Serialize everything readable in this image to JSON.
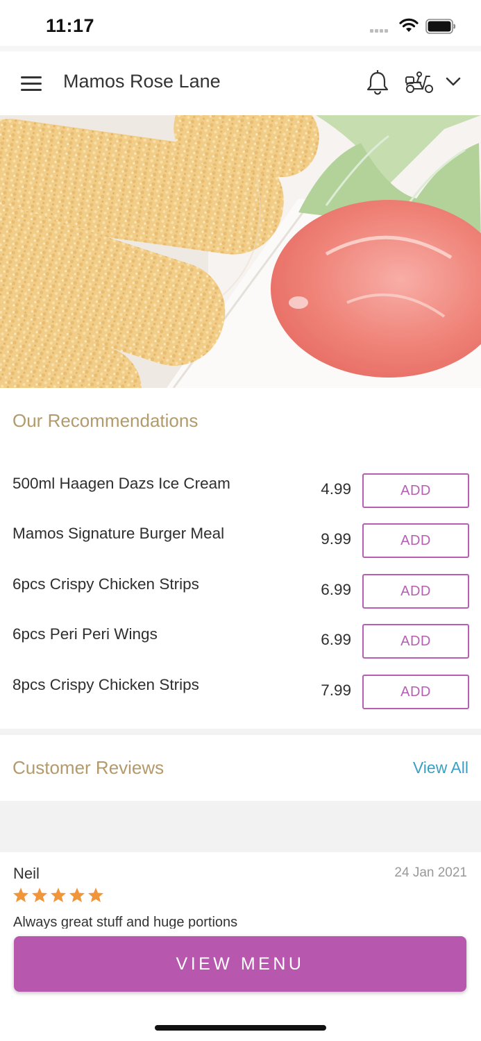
{
  "status_bar": {
    "time": "11:17"
  },
  "header": {
    "title": "Mamos Rose Lane",
    "icons": [
      "hamburger-menu-icon",
      "bell-icon",
      "scooter-icon",
      "chevron-down-icon"
    ]
  },
  "hero": {
    "image": "crispy-chicken-strips-with-ketchup-photo"
  },
  "recommendations": {
    "title": "Our Recommendations",
    "add_label": "ADD",
    "items": [
      {
        "name": "500ml Haagen Dazs Ice Cream",
        "price": "4.99"
      },
      {
        "name": "Mamos Signature Burger Meal",
        "price": "9.99"
      },
      {
        "name": "6pcs Crispy Chicken Strips",
        "price": "6.99"
      },
      {
        "name": "6pcs Peri Peri Wings",
        "price": "6.99"
      },
      {
        "name": "8pcs Crispy Chicken Strips",
        "price": "7.99"
      }
    ]
  },
  "reviews": {
    "title": "Customer Reviews",
    "view_all": "View All",
    "items": [
      {
        "name": "Neil",
        "date": "24 Jan 2021",
        "rating": 5,
        "text": "Always great stuff and huge portions"
      }
    ]
  },
  "cta": {
    "label": "VIEW MENU"
  },
  "colors": {
    "accent": "#b757ad",
    "heading_gold": "#b39a6c",
    "link_blue": "#3a9fc4",
    "star_orange": "#f0953a"
  }
}
